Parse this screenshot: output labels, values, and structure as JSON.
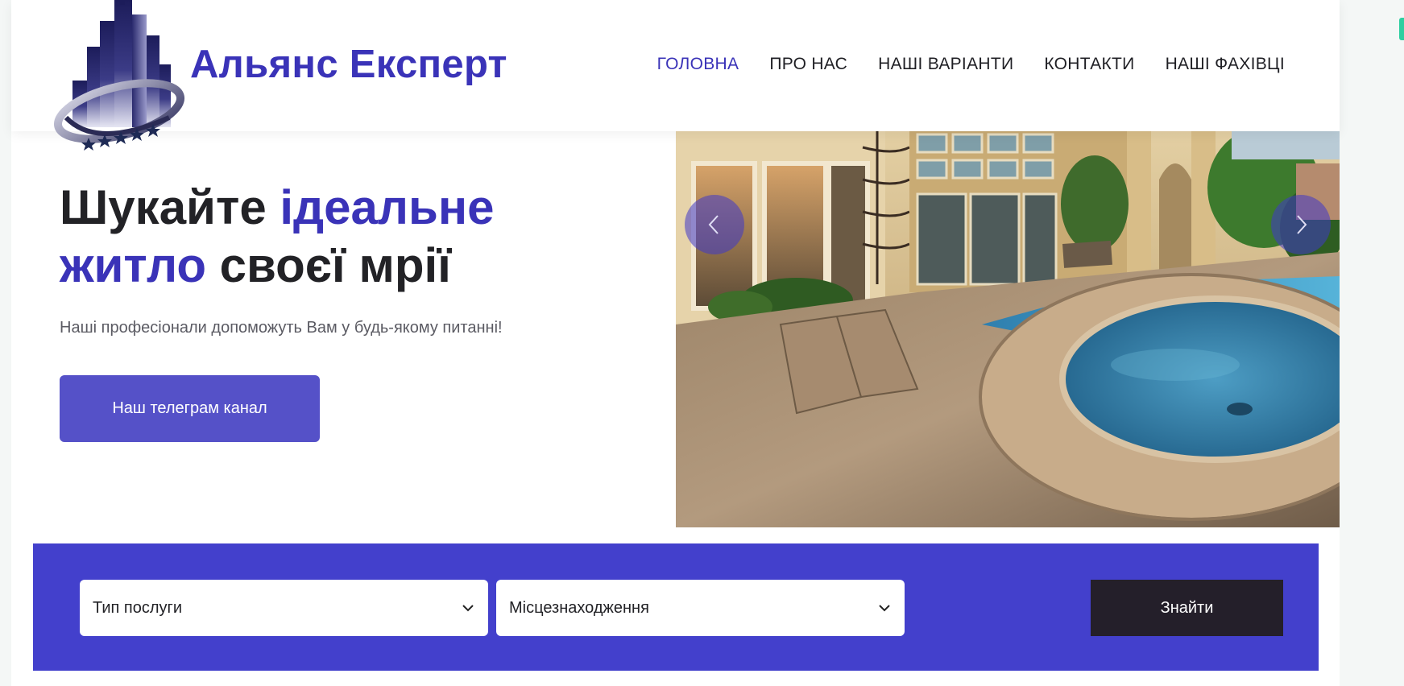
{
  "header": {
    "brand": "Альянс Експерт",
    "nav": [
      {
        "label": "ГОЛОВНА",
        "active": true
      },
      {
        "label": "ПРО НАС",
        "active": false
      },
      {
        "label": "НАШІ ВАРІАНТИ",
        "active": false
      },
      {
        "label": "КОНТАКТИ",
        "active": false
      },
      {
        "label": "НАШІ ФАХІВЦІ",
        "active": false
      }
    ]
  },
  "hero": {
    "title_part1": "Шукайте ",
    "title_accent1": "ідеальне",
    "title_accent2": "житло",
    "title_part2": " своєї мрії",
    "subtitle": "Наші професіонали допоможуть Вам у будь-якому питанні!",
    "button": "Наш телеграм канал"
  },
  "slider": {
    "prev_icon": "chevron-left-icon",
    "next_icon": "chevron-right-icon"
  },
  "search": {
    "service_type": "Тип послуги",
    "location": "Місцезнаходження",
    "submit": "Знайти"
  },
  "colors": {
    "accent": "#3a33b8",
    "search_bg": "#4340cc",
    "button_bg": "#5551c8",
    "dark_button": "#241f2a"
  }
}
